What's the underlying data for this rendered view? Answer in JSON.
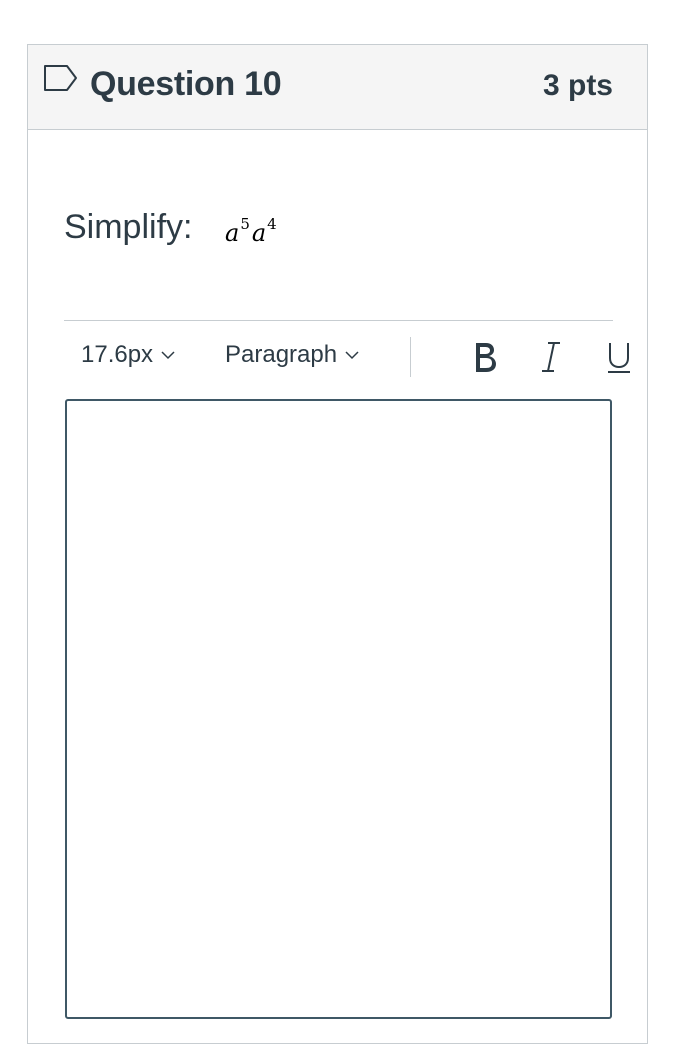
{
  "question": {
    "title": "Question 10",
    "points": "3 pts",
    "flag_icon": "flag-outline-icon"
  },
  "prompt": {
    "label": "Simplify:",
    "math": {
      "base1": "a",
      "exp1": "5",
      "base2": "a",
      "exp2": "4"
    }
  },
  "toolbar": {
    "font_size": "17.6px",
    "block_format": "Paragraph",
    "bold_icon": "bold-icon",
    "italic_icon": "italic-icon",
    "underline_icon": "underline-icon"
  },
  "editor": {
    "content": ""
  },
  "colors": {
    "header_bg": "#f5f5f5",
    "border": "#c7cdd1",
    "text": "#2d3b45",
    "editor_border": "#3f5866"
  }
}
